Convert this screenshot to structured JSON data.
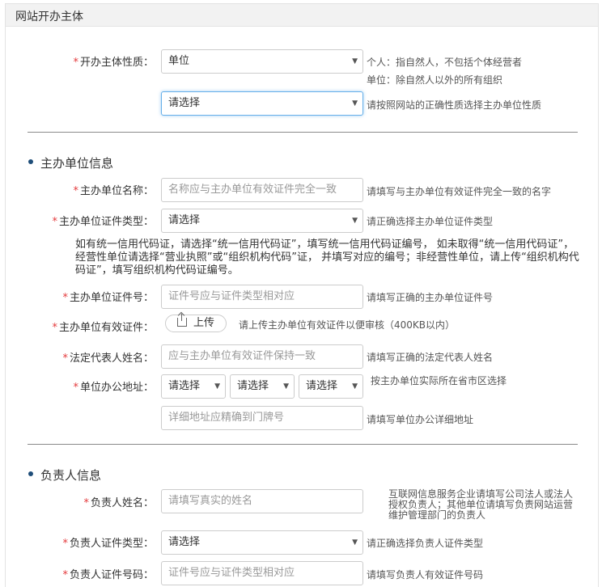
{
  "header": {
    "title": "网站开办主体"
  },
  "nature": {
    "label": "开办主体性质：",
    "select1_value": "单位",
    "hint1_line1": "个人：指自然人，不包括个体经营者",
    "hint1_line2": "单位：除自然人以外的所有组织",
    "select2_value": "请选择",
    "hint2": "请按照网站的正确性质选择主办单位性质"
  },
  "org_section": {
    "title": "主办单位信息",
    "name": {
      "label": "主办单位名称：",
      "placeholder": "名称应与主办单位有效证件完全一致",
      "hint": "请填写与主办单位有效证件完全一致的名字"
    },
    "cert_type": {
      "label": "主办单位证件类型：",
      "value": "请选择",
      "hint": "请正确选择主办单位证件类型"
    },
    "note": "如有统一信用代码证，请选择“统一信用代码证”，填写统一信用代码证编号， 如未取得“统一信用代码证”，经营性单位请选择“营业执照”或“组织机构代码”证， 并填写对应的编号；非经营性单位，请上传“组织机构代码证”，填写组织机构代码证编号。",
    "cert_no": {
      "label": "主办单位证件号：",
      "placeholder": "证件号应与证件类型相对应",
      "hint": "请填写正确的主办单位证件号"
    },
    "cert_file": {
      "label": "主办单位有效证件：",
      "button": "上传",
      "hint": "请上传主办单位有效证件以便审核（400KB以内）"
    },
    "legal_rep": {
      "label": "法定代表人姓名：",
      "placeholder": "应与主办单位有效证件保持一致",
      "hint": "请填写正确的法定代表人姓名"
    },
    "address": {
      "label": "单位办公地址：",
      "province": "请选择",
      "city": "请选择",
      "district": "请选择",
      "hint": "按主办单位实际所在省市区选择",
      "detail_placeholder": "详细地址应精确到门牌号",
      "detail_hint": "请填写单位办公详细地址"
    }
  },
  "person_section": {
    "title": "负责人信息",
    "name": {
      "label": "负责人姓名：",
      "placeholder": "请填写真实的姓名",
      "hint_line1": "互联网信息服务企业请填写公司法人或法人",
      "hint_line2": "授权负责人；其他单位请填写负责网站运营",
      "hint_line3": "维护管理部门的负责人"
    },
    "cert_type": {
      "label": "负责人证件类型：",
      "value": "请选择",
      "hint": "请正确选择负责人证件类型"
    },
    "cert_no": {
      "label": "负责人证件号码：",
      "placeholder": "证件号应与证件类型相对应",
      "hint": "请填写负责人有效证件号码"
    }
  }
}
